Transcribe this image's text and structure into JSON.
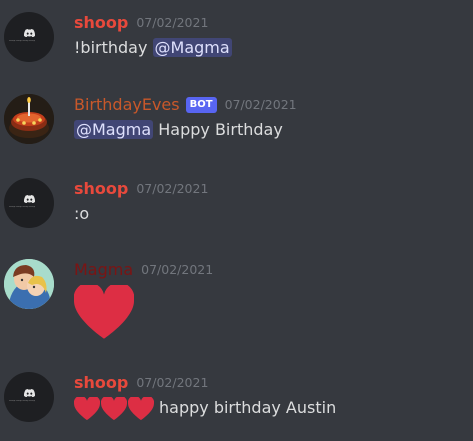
{
  "messages": [
    {
      "username": "shoop",
      "timestamp": "07/02/2021",
      "text": "!birthday ",
      "mention": "@Magma",
      "avatar": "discord-logo-icon"
    },
    {
      "username": "BirthdayEves",
      "badge": "BOT",
      "timestamp": "07/02/2021",
      "mention": "@Magma",
      "text": " Happy Birthday",
      "avatar": "birthday-cake-avatar"
    },
    {
      "username": "shoop",
      "timestamp": "07/02/2021",
      "text": ":o",
      "avatar": "discord-logo-icon"
    },
    {
      "username": "Magma",
      "timestamp": "07/02/2021",
      "emoji": "red-heart-icon",
      "avatar": "anime-couple-avatar"
    },
    {
      "username": "shoop",
      "timestamp": "07/02/2021",
      "emoji": "red-heart-icon",
      "emoji_count": 3,
      "text": "happy birthday Austin",
      "avatar": "discord-logo-icon"
    }
  ],
  "colors": {
    "background": "#36393f",
    "shoop": "#e8493c",
    "birthdayeves": "#c9582a",
    "magma": "#7b1414",
    "heart": "#dd2e44",
    "mention_bg": "#414675",
    "bot_badge": "#5865f2"
  }
}
